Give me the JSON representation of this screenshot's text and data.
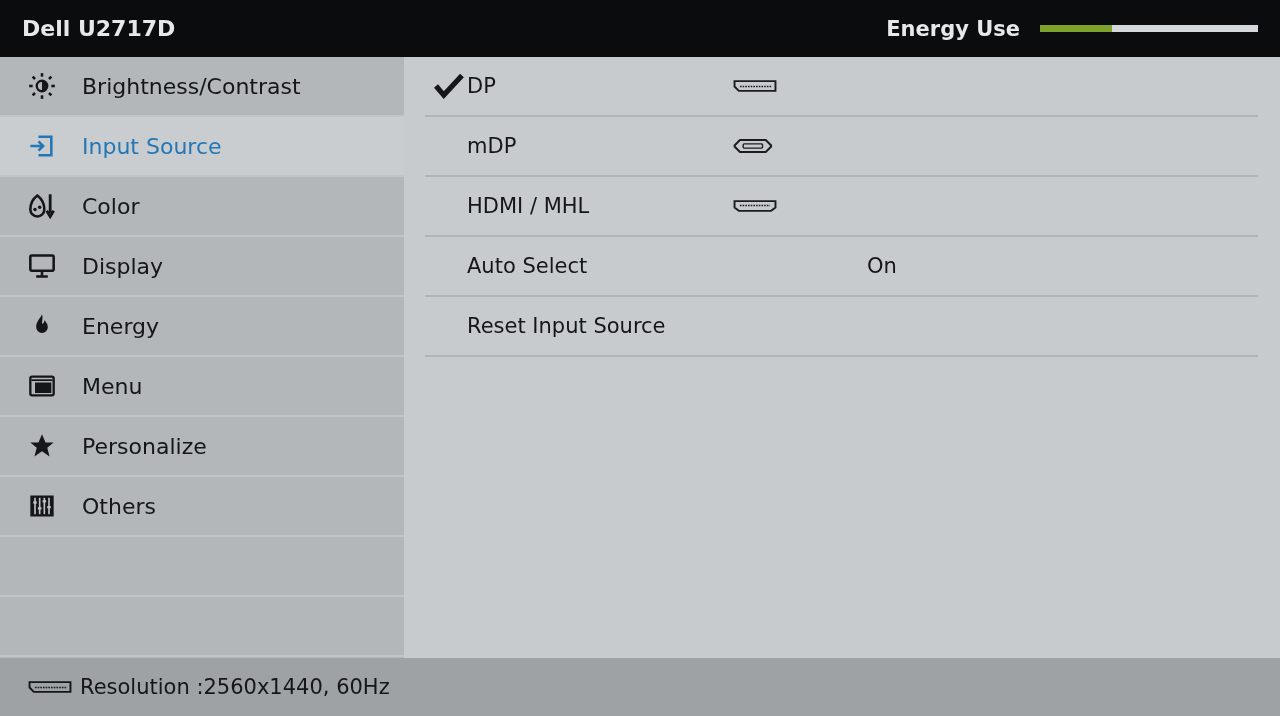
{
  "header": {
    "title": "Dell U2717D",
    "energy_label": "Energy Use",
    "energy": {
      "level": 0.33
    }
  },
  "sidebar": {
    "items": [
      {
        "label": "Brightness/Contrast",
        "selected": false
      },
      {
        "label": "Input Source",
        "selected": true
      },
      {
        "label": "Color",
        "selected": false
      },
      {
        "label": "Display",
        "selected": false
      },
      {
        "label": "Energy",
        "selected": false
      },
      {
        "label": "Menu",
        "selected": false
      },
      {
        "label": "Personalize",
        "selected": false
      },
      {
        "label": "Others",
        "selected": false
      }
    ]
  },
  "options": [
    {
      "kind": "input",
      "label": "DP",
      "checked": true
    },
    {
      "kind": "input",
      "label": "mDP",
      "checked": false
    },
    {
      "kind": "input",
      "label": "HDMI / MHL",
      "checked": false
    },
    {
      "kind": "setting",
      "label": "Auto Select",
      "value": "On"
    },
    {
      "kind": "action",
      "label": "Reset Input Source"
    }
  ],
  "status_bar": {
    "text": "Resolution :2560x1440, 60Hz"
  }
}
